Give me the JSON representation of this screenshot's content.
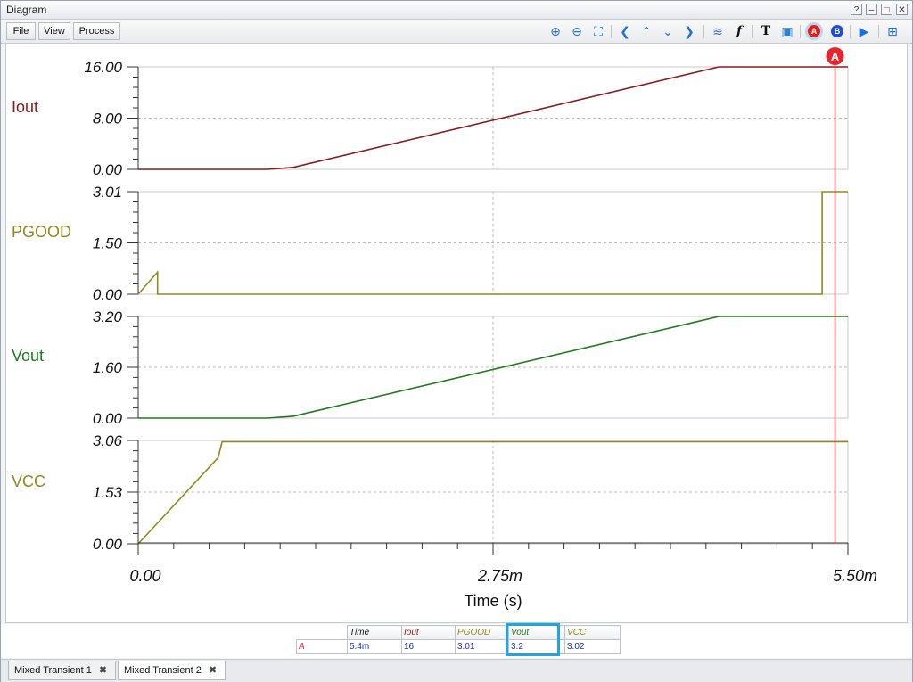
{
  "window": {
    "title": "Diagram",
    "controls": [
      "?",
      "–",
      "□",
      "✕"
    ]
  },
  "menu": [
    "File",
    "View",
    "Process"
  ],
  "toolbar_icons": [
    {
      "name": "zoom-in-icon",
      "glyph": "⊕",
      "color": "#2c6fd1"
    },
    {
      "name": "zoom-out-icon",
      "glyph": "⊖",
      "color": "#2c6fd1"
    },
    {
      "name": "zoom-fit-icon",
      "glyph": "⛶",
      "color": "#2c6fd1"
    },
    {
      "name": "arrow-left-icon",
      "glyph": "❮",
      "color": "#1f6fd6"
    },
    {
      "name": "arrow-up-icon",
      "glyph": "⌃",
      "color": "#1f6fd6"
    },
    {
      "name": "arrow-down-icon",
      "glyph": "⌄",
      "color": "#1f6fd6"
    },
    {
      "name": "arrow-right-icon",
      "glyph": "❯",
      "color": "#1f6fd6"
    },
    {
      "name": "waveform-icon",
      "glyph": "≋",
      "color": "#3a6ad0"
    },
    {
      "name": "function-icon",
      "glyph": "f",
      "color": "#111111"
    },
    {
      "name": "text-icon",
      "glyph": "T",
      "color": "#111111"
    },
    {
      "name": "comment-icon",
      "glyph": "▣",
      "color": "#2a7fd6"
    },
    {
      "name": "cursor-a-icon",
      "glyph": "A",
      "color": "#e02020"
    },
    {
      "name": "cursor-b-icon",
      "glyph": "B",
      "color": "#1f4fd6"
    },
    {
      "name": "play-icon",
      "glyph": "▶",
      "color": "#1f6fd6"
    },
    {
      "name": "add-window-icon",
      "glyph": "⊞",
      "color": "#1f6fd6"
    }
  ],
  "chart_data": {
    "type": "line",
    "xlabel": "Time (s)",
    "x_range": [
      0,
      0.0055
    ],
    "x_tick_labels": [
      "0.00",
      "2.75m",
      "5.50m"
    ],
    "cursor": {
      "label": "A",
      "x": 0.0054,
      "color": "#e8252b"
    },
    "panels": [
      {
        "name": "Iout",
        "color": "#8b1a1a",
        "ylim": [
          0,
          16
        ],
        "tick_labels": [
          "16.00",
          "8.00",
          "0.00"
        ],
        "x": [
          0,
          0.001,
          0.0012,
          0.0045,
          0.0055
        ],
        "y": [
          0,
          0,
          0.3,
          16,
          16
        ]
      },
      {
        "name": "PGOOD",
        "color": "#8f8a1e",
        "ylim": [
          0,
          3.01
        ],
        "tick_labels": [
          "3.01",
          "1.50",
          "0.00"
        ],
        "x": [
          0,
          0.00015,
          0.00015,
          0.0053,
          0.0053,
          0.0055
        ],
        "y": [
          0,
          0.65,
          0,
          0,
          3.01,
          3.01
        ]
      },
      {
        "name": "Vout",
        "color": "#1f7a1f",
        "ylim": [
          0,
          3.2
        ],
        "tick_labels": [
          "3.20",
          "1.60",
          "0.00"
        ],
        "x": [
          0,
          0.001,
          0.0012,
          0.0045,
          0.0055
        ],
        "y": [
          0,
          0,
          0.06,
          3.2,
          3.2
        ]
      },
      {
        "name": "VCC",
        "color": "#8f8a1e",
        "ylim": [
          0,
          3.06
        ],
        "tick_labels": [
          "3.06",
          "1.53",
          "0.00"
        ],
        "x": [
          0,
          0.00062,
          0.00065,
          0.0055
        ],
        "y": [
          0,
          2.55,
          3.02,
          3.02
        ]
      }
    ]
  },
  "cursor_table": {
    "headers": [
      "Time",
      "Iout",
      "PGOOD",
      "Vout",
      "VCC"
    ],
    "header_colors": [
      "#111111",
      "#8b1a1a",
      "#8f8a1e",
      "#1f7a1f",
      "#8f8a1e"
    ],
    "row_label": "A",
    "values": [
      "5.4m",
      "16",
      "3.01",
      "3.2",
      "3.02"
    ]
  },
  "tabs": [
    {
      "label": "Mixed Transient 1",
      "active": false
    },
    {
      "label": "Mixed Transient 2",
      "active": true
    }
  ]
}
